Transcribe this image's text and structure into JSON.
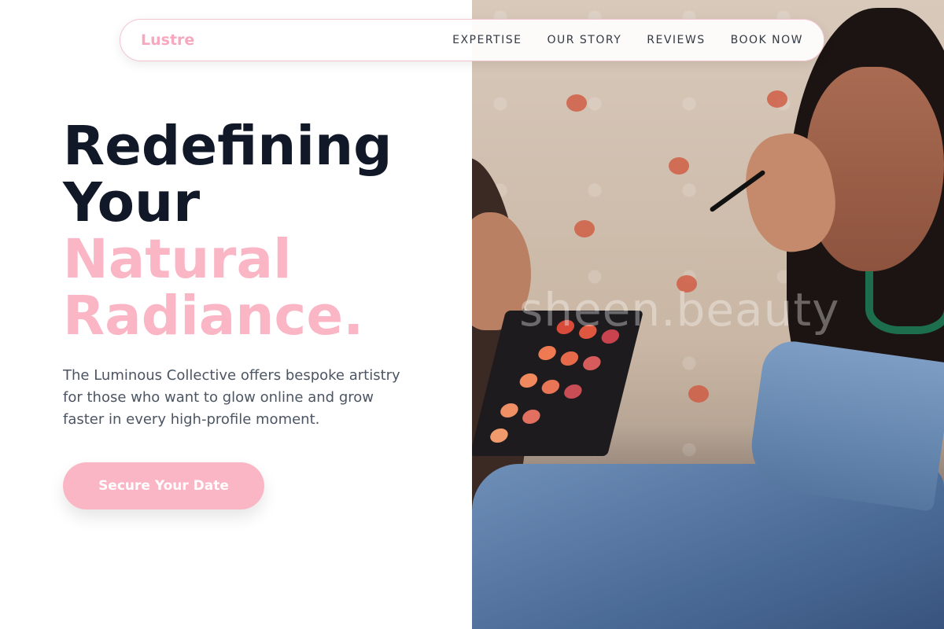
{
  "nav": {
    "logo": "Lustre",
    "links": [
      "EXPERTISE",
      "OUR STORY",
      "REVIEWS",
      "BOOK NOW"
    ]
  },
  "hero": {
    "line1": "Redefining",
    "line2": "Your",
    "line3": "Natural",
    "line4": "Radiance.",
    "description": "The Luminous Collective offers bespoke artistry for those who want to glow online and grow faster in every high-profile moment.",
    "cta_label": "Secure Your Date"
  },
  "photo": {
    "watermark": "sheen.beauty"
  },
  "colors": {
    "accent_pink": "#fbb6c6",
    "heading_dark": "#111827",
    "body_text": "#4b5563"
  }
}
